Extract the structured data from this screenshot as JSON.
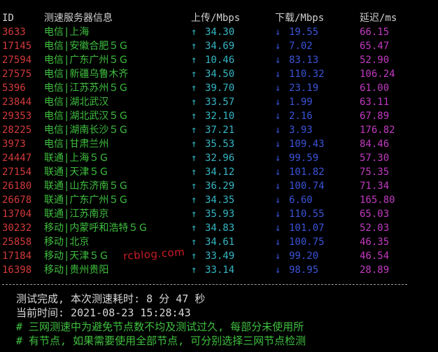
{
  "header": {
    "id": "ID",
    "server": "测速服务器信息",
    "upload": "上传/Mbps",
    "download": "下载/Mbps",
    "latency": "延迟/ms"
  },
  "arrows": {
    "up": "↑",
    "down": "↓"
  },
  "rows": [
    {
      "id": "3633",
      "server": "电信|上海",
      "upload": "34.30",
      "download": "19.55",
      "latency": "66.15"
    },
    {
      "id": "17145",
      "server": "电信|安徽合肥５Ｇ",
      "upload": "34.69",
      "download": "7.02",
      "latency": "65.47"
    },
    {
      "id": "27594",
      "server": "电信|广东广州５Ｇ",
      "upload": "10.46",
      "download": "83.13",
      "latency": "52.90"
    },
    {
      "id": "27575",
      "server": "电信|新疆乌鲁木齐",
      "upload": "34.50",
      "download": "110.32",
      "latency": "106.24"
    },
    {
      "id": "5396",
      "server": "电信|江苏苏州５Ｇ",
      "upload": "39.70",
      "download": "23.19",
      "latency": "61.00"
    },
    {
      "id": "23844",
      "server": "电信|湖北武汉",
      "upload": "33.57",
      "download": "1.99",
      "latency": "63.11"
    },
    {
      "id": "29353",
      "server": "电信|湖北武汉５Ｇ",
      "upload": "32.10",
      "download": "2.16",
      "latency": "67.89"
    },
    {
      "id": "28225",
      "server": "电信|湖南长沙５Ｇ",
      "upload": "37.21",
      "download": "3.93",
      "latency": "176.82"
    },
    {
      "id": "3973",
      "server": "电信|甘肃兰州",
      "upload": "35.53",
      "download": "109.43",
      "latency": "84.46"
    },
    {
      "id": "24447",
      "server": "联通|上海５Ｇ",
      "upload": "32.96",
      "download": "99.59",
      "latency": "57.30"
    },
    {
      "id": "27154",
      "server": "联通|天津５Ｇ",
      "upload": "34.12",
      "download": "101.82",
      "latency": "75.35"
    },
    {
      "id": "26180",
      "server": "联通|山东济南５Ｇ",
      "upload": "36.29",
      "download": "100.74",
      "latency": "71.34"
    },
    {
      "id": "26678",
      "server": "联通|广东广州５Ｇ",
      "upload": "34.35",
      "download": "6.60",
      "latency": "165.80"
    },
    {
      "id": "13704",
      "server": "联通|江苏南京",
      "upload": "35.93",
      "download": "110.55",
      "latency": "65.03"
    },
    {
      "id": "30232",
      "server": "移动|内蒙呼和浩特５Ｇ",
      "upload": "34.83",
      "download": "101.07",
      "latency": "52.03"
    },
    {
      "id": "25858",
      "server": "移动|北京",
      "upload": "34.61",
      "download": "100.75",
      "latency": "46.35"
    },
    {
      "id": "17184",
      "server": "移动|天津５Ｇ",
      "upload": "33.49",
      "download": "99.20",
      "latency": "46.54"
    },
    {
      "id": "16398",
      "server": "移动|贵州贵阳",
      "upload": "33.14",
      "download": "98.95",
      "latency": "28.89"
    }
  ],
  "footer": {
    "completed": "测试完成, 本次测速耗时: 8 分 47 秒",
    "current_time": "当前时间: 2021-08-23 15:28:43",
    "note1": "# 三网测速中为避免节点数不均及测试过久, 每部分未使用所",
    "note2": "# 有节点, 如果需要使用全部节点, 可分别选择三网节点检测"
  },
  "watermark": "rcblog.com",
  "colors": {
    "background": "#000000",
    "id": "#d23a3a",
    "server": "#3fc03f",
    "upload": "#35b6c4",
    "download": "#3a54d8",
    "latency": "#c23ac2",
    "watermark": "#e0202a"
  }
}
